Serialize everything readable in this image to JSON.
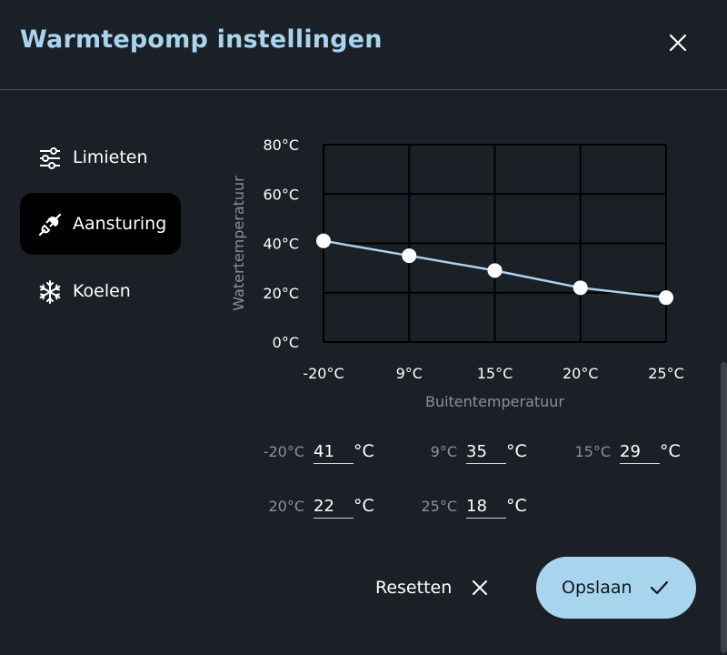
{
  "dialog": {
    "title": "Warmtepomp instellingen",
    "close_icon": "close-icon"
  },
  "sidebar": {
    "items": [
      {
        "label": "Limieten",
        "icon": "sliders-icon",
        "active": false
      },
      {
        "label": "Aansturing",
        "icon": "plug-icon",
        "active": true
      },
      {
        "label": "Koelen",
        "icon": "snowflake-icon",
        "active": false
      }
    ]
  },
  "chart_data": {
    "type": "line",
    "x": [
      "-20°C",
      "9°C",
      "15°C",
      "20°C",
      "25°C"
    ],
    "values": [
      41,
      35,
      29,
      22,
      18
    ],
    "xlabel": "Buitentemperatuur",
    "ylabel": "Watertemperatuur",
    "yticks": [
      "0°C",
      "20°C",
      "40°C",
      "60°C",
      "80°C"
    ],
    "ylim": [
      0,
      80
    ],
    "grid": true,
    "colors": {
      "line": "#a9d4ee",
      "point": "#ffffff",
      "grid": "#000000"
    }
  },
  "fields": [
    {
      "label": "-20°C",
      "value": "41",
      "unit": "°C"
    },
    {
      "label": "9°C",
      "value": "35",
      "unit": "°C"
    },
    {
      "label": "15°C",
      "value": "29",
      "unit": "°C"
    },
    {
      "label": "20°C",
      "value": "22",
      "unit": "°C"
    },
    {
      "label": "25°C",
      "value": "18",
      "unit": "°C"
    }
  ],
  "footer": {
    "reset_label": "Resetten",
    "save_label": "Opslaan"
  },
  "colors": {
    "background": "#1b2026",
    "accent": "#a9d4ee",
    "active_item": "#000000"
  }
}
